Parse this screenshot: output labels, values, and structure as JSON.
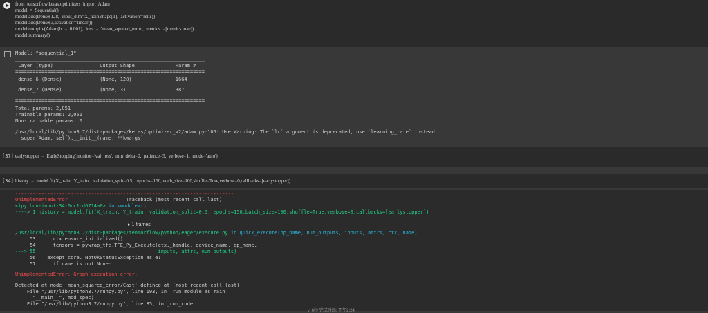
{
  "cell1": {
    "lines": [
      "from  tensorflow.keras.optimizers  import  Adam",
      "model  =  Sequential()",
      "model.add(Dense(128,  input_dim=X_train.shape[1],  activation='relu'))",
      "model.add(Dense(3,activation='linear'))",
      "model.compile(Adam(lr  =  0.001),  loss  =  'mean_squared_error',  metrics  =[metrics.mae])",
      "model.summary()"
    ]
  },
  "summary": {
    "model_line": "Model: \"sequential_1\"",
    "rule1": "_________________________________________________________________",
    "header": " Layer (type)                Output Shape              Param #   ",
    "rule2": "=================================================================",
    "row1": " dense_6 (Dense)             (None, 128)               1664      ",
    "row2": " dense_7 (Dense)             (None, 3)                 387       ",
    "rule3": "=================================================================",
    "total": "Total params: 2,051",
    "trainable": "Trainable params: 2,051",
    "nontrainable": "Non-trainable params: 0",
    "rule4": "_________________________________________________________________",
    "warn1": "/usr/local/lib/python3.7/dist-packages/keras/optimizer_v2/adam.py:105: UserWarning: The `lr` argument is deprecated, use `learning_rate` instead.",
    "warn2": "  super(Adam, self).__init__(name, **kwargs)"
  },
  "cell2": {
    "count": "[37]",
    "code": "earlystopper  =  EarlyStopping(monitor='val_loss',  min_delta=0,  patience=5,  verbose=1,  mode='auto')"
  },
  "cell3": {
    "count": "[34]",
    "code": "history  =  model.fit(X_train,  Y_train,   validation_split=0.5,   epochs=150,batch_size=100,shuffle=True,verbose=0,callbacks=[earlystopper])"
  },
  "error": {
    "dashes": "---------------------------------------------------------------------------",
    "err_name": "UnimplementedError",
    "traceback_label": "Traceback (most recent call last)",
    "ipython_input": "<ipython-input-34-0cc1cd6714a0>",
    "in_module": " in <module>()",
    "arrow_line": "----> 1 history = model.fit(X_train, Y_train, validation_split=0.5, epochs=150,batch_size=100,shuffle=True,verbose=0,callbacks=[earlystopper])",
    "frames_label": "1 frames",
    "file_path": "/usr/local/lib/python3.7/dist-packages/tensorflow/python/eager/execute.py",
    "file_in": " in quick_execute(op_name, num_outputs, inputs, attrs, ctx, name)",
    "l53": "     53      ctx.ensure_initialized()",
    "l54": "     54      tensors = pywrap_tfe.TFE_Py_Execute(ctx._handle, device_name, op_name,",
    "l55": "---> 55                                          inputs, attrs, num_outputs)",
    "l56": "     56    except core._NotOkStatusException as e:",
    "l57": "     57      if name is not None:",
    "final": "UnimplementedError: Graph execution error:",
    "detected": "Detected at node 'mean_squared_error/Cast' defined at (most recent call last):",
    "f1": "    File \"/usr/lib/python3.7/runpy.py\", line 193, in _run_module_as_main",
    "f2": "      \"__main__\", mod_spec)",
    "f3": "    File \"/usr/lib/python3.7/runpy.py\", line 85, in _run_code"
  },
  "status_text": "✓ 0秒   完成时间: 下午2:24"
}
